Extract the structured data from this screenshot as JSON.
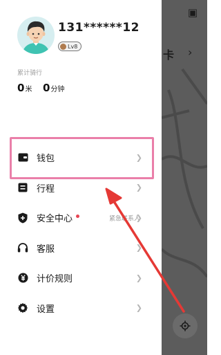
{
  "user": {
    "phone": "131******12",
    "level": "Lv8"
  },
  "stats": {
    "caption": "累计骑行",
    "distance": {
      "value": "0",
      "unit": "米"
    },
    "duration": {
      "value": "0",
      "unit": "分钟"
    }
  },
  "menu": [
    {
      "label": "钱包",
      "icon": "wallet-icon"
    },
    {
      "label": "行程",
      "icon": "trip-icon"
    },
    {
      "label": "安全中心",
      "icon": "shield-icon",
      "hint": "紧急联系人"
    },
    {
      "label": "客服",
      "icon": "headset-icon"
    },
    {
      "label": "计价规则",
      "icon": "yuan-icon"
    },
    {
      "label": "设置",
      "icon": "gear-icon"
    }
  ],
  "map": {
    "card_text": "卡"
  },
  "colors": {
    "highlight": "#ea7fa9",
    "arrow": "#e53935",
    "badge_dot": "#e64553"
  }
}
